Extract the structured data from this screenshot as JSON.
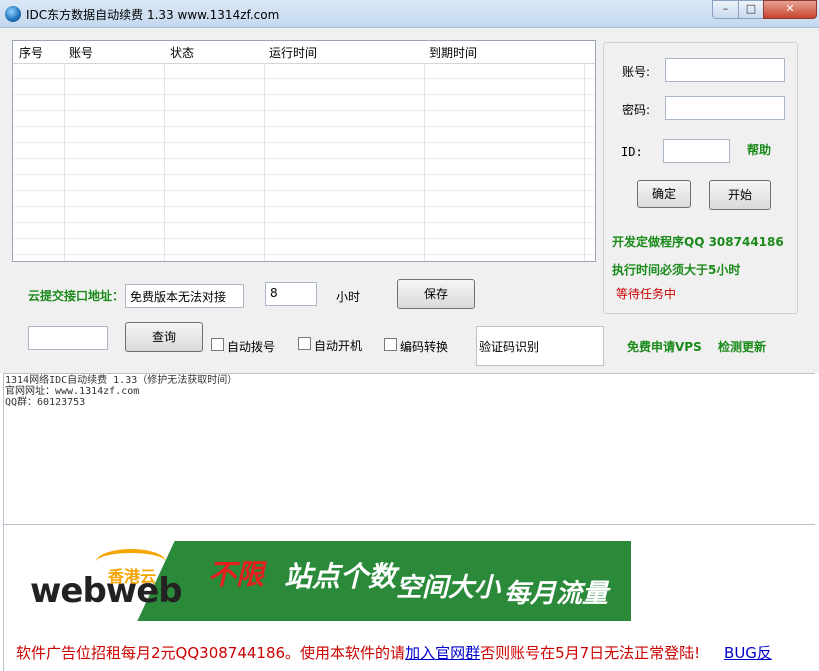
{
  "window": {
    "title": "IDC东方数据自动续费 1.33  www.1314zf.com",
    "controls": {
      "minimize": "–",
      "maximize": "□",
      "close": "✕"
    }
  },
  "table": {
    "columns": [
      "序号",
      "账号",
      "状态",
      "运行时间",
      "到期时间"
    ],
    "rows": []
  },
  "login": {
    "account_label": "账号:",
    "account_value": "",
    "password_label": "密码:",
    "password_value": "",
    "id_label": "ID:",
    "id_value": "",
    "help_link": "帮助",
    "confirm_button": "确定",
    "start_button": "开始",
    "dev_note": "开发定做程序QQ 308744186",
    "exec_note": "执行时间必须大于5小时",
    "status": "等待任务中"
  },
  "submit": {
    "label": "云提交接口地址：",
    "url_value": "免费版本无法对接",
    "hours_value": "8",
    "hours_unit": "小时",
    "save_button": "保存"
  },
  "query": {
    "input_value": "",
    "query_button": "查询",
    "auto_dial": "自动拨号",
    "auto_boot": "自动开机",
    "encode_convert": "编码转换",
    "captcha": "验证码识别",
    "free_vps": "免费申请VPS",
    "check_update": "检测更新"
  },
  "log": [
    "1314网络IDC自动续费 1.33（修护无法获取时间）",
    "官网网址：www.1314zf.com",
    "QQ群：60123753"
  ],
  "banner": {
    "logo": "webweb",
    "logo_sub": "香港云",
    "highlight": "不限",
    "word1": "站点个数",
    "word2": "空间大小",
    "word3": "每月流量"
  },
  "ad": {
    "text1": "软件广告位招租每月2元QQ308744186。使用本软件的请",
    "link1": "加入官网群",
    "text2": "否则账号在5月7日无法正常登陆!",
    "link2": "BUG反"
  },
  "colors": {
    "accent_green": "#1a8a1a",
    "status_red": "#cc0000",
    "banner_green": "#2a8a3a"
  }
}
